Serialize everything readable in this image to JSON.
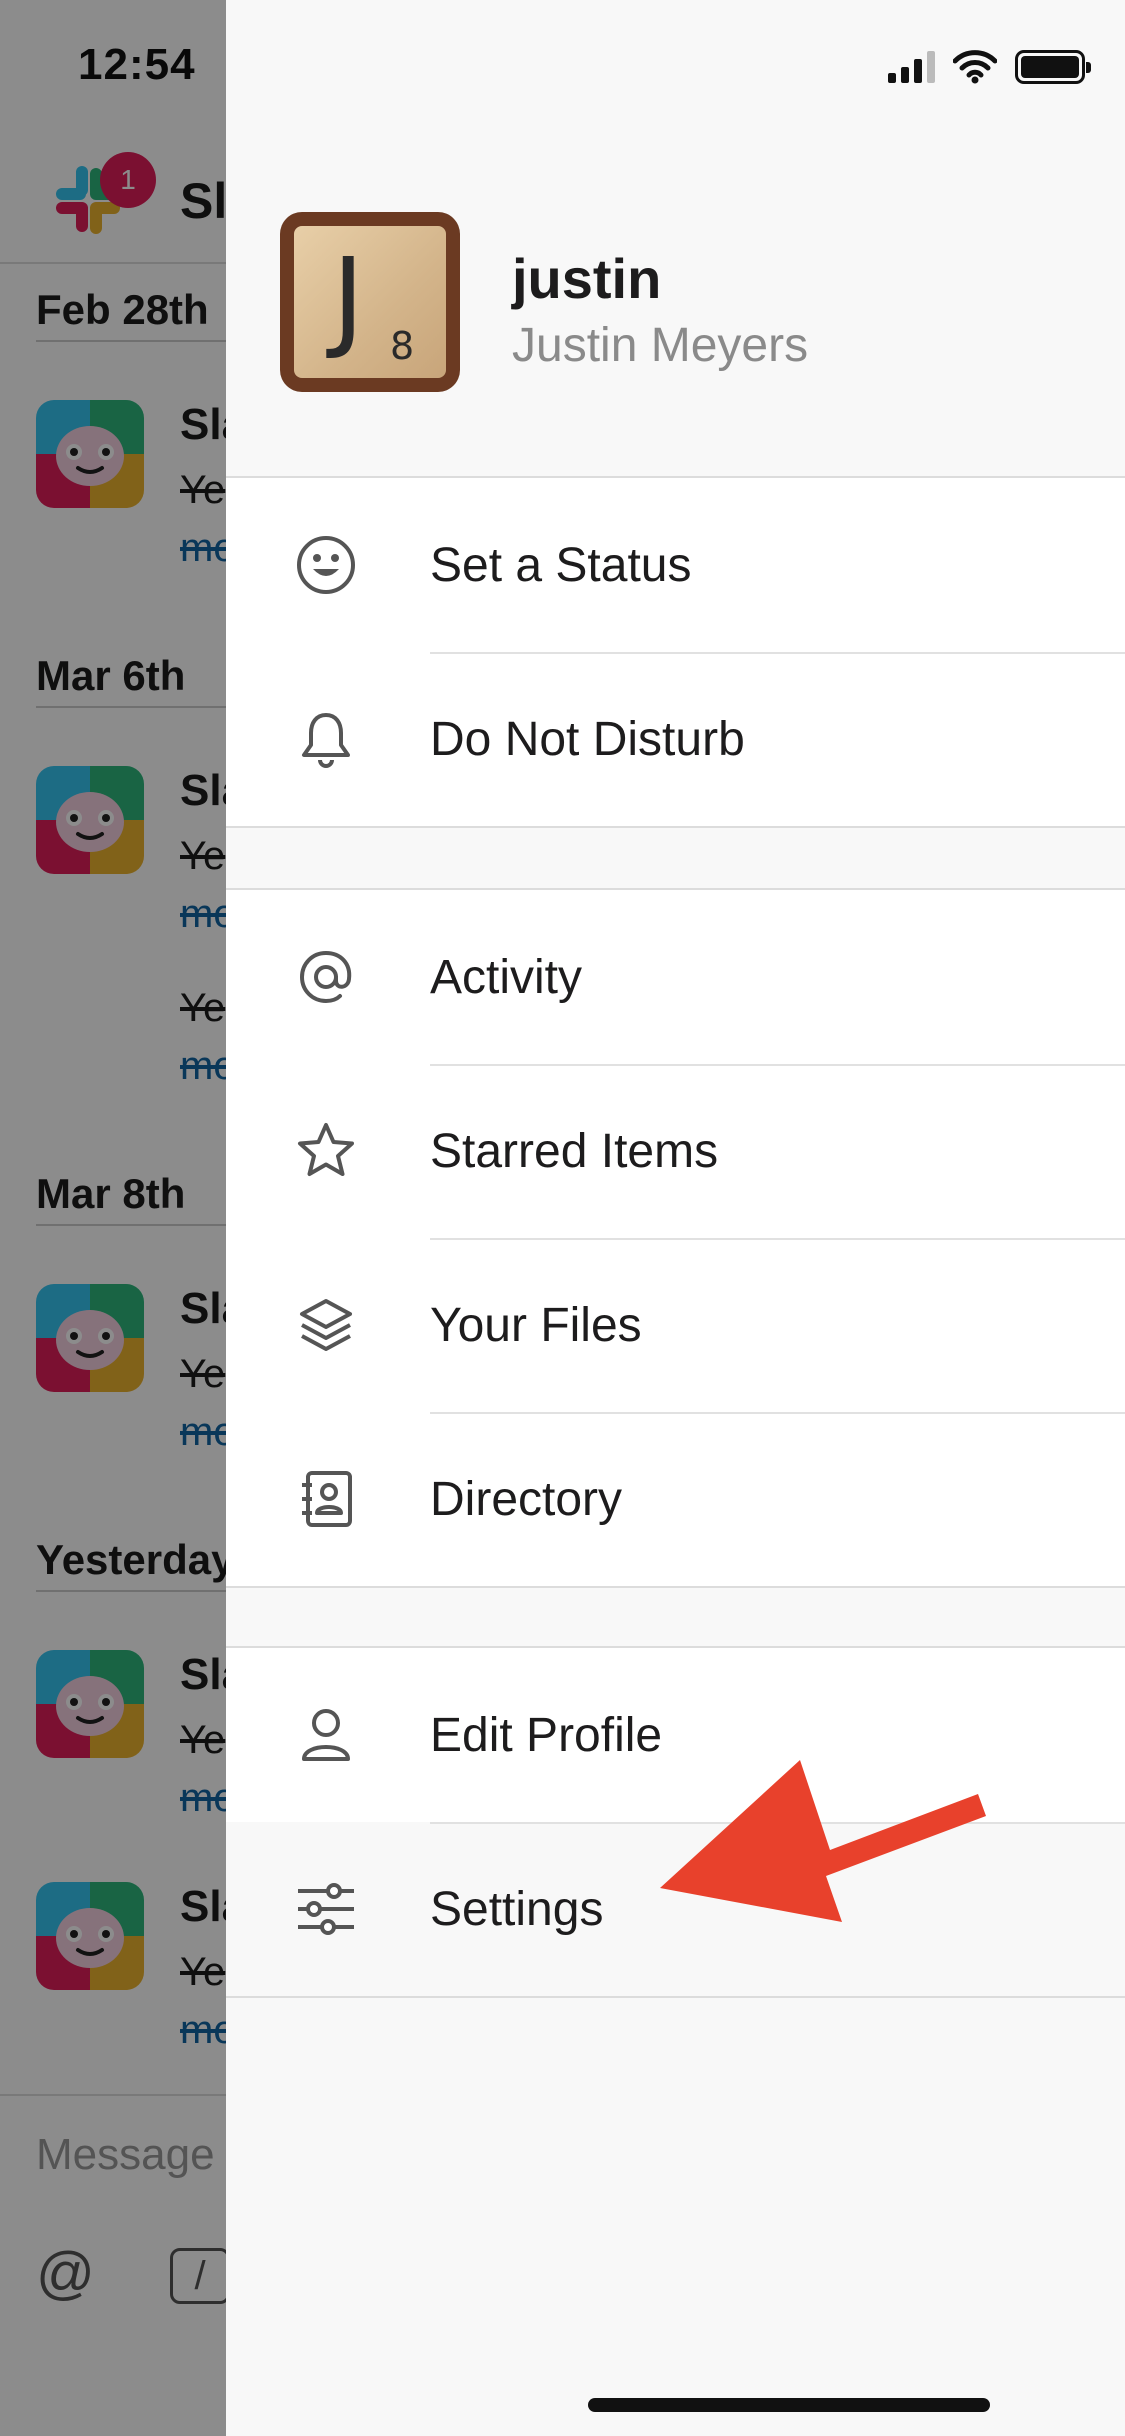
{
  "status_bar": {
    "time": "12:54"
  },
  "channel": {
    "title": "Sla",
    "unread_badge": "1",
    "bot_name": "Sla",
    "message_line1": "Ye",
    "message_line2": "mo",
    "date_dividers": [
      "Feb 28th",
      "Mar 6th",
      "Mar 8th",
      "Yesterday"
    ]
  },
  "composer": {
    "placeholder": "Message",
    "at_symbol": "@",
    "slash_symbol": "/"
  },
  "profile": {
    "handle": "justin",
    "full_name": "Justin Meyers",
    "avatar": {
      "letter": "J",
      "number": "8"
    }
  },
  "menu": {
    "status_group": [
      {
        "label": "Set a Status",
        "icon": "smiley-icon"
      },
      {
        "label": "Do Not Disturb",
        "icon": "bell-icon"
      }
    ],
    "main_group": [
      {
        "label": "Activity",
        "icon": "at-sign-icon"
      },
      {
        "label": "Starred Items",
        "icon": "star-icon"
      },
      {
        "label": "Your Files",
        "icon": "layers-icon"
      },
      {
        "label": "Directory",
        "icon": "contact-book-icon"
      }
    ],
    "account_group": [
      {
        "label": "Edit Profile",
        "icon": "person-icon"
      },
      {
        "label": "Settings",
        "icon": "sliders-icon"
      }
    ]
  },
  "colors": {
    "arrow": "#e8412c",
    "badge": "#e01e5a",
    "link": "#1264a3"
  }
}
